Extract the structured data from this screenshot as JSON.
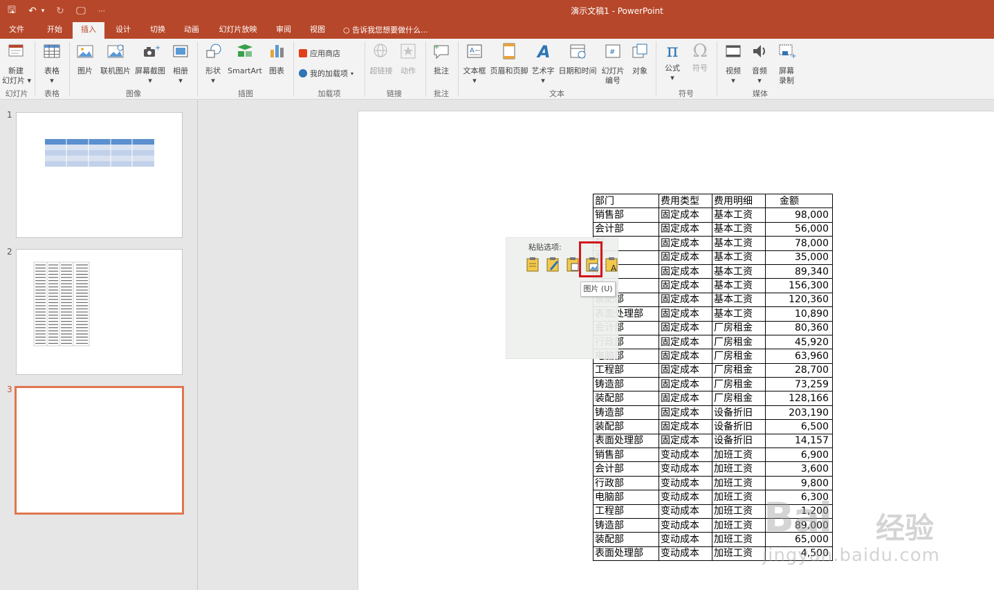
{
  "window": {
    "title": "演示文稿1 - PowerPoint",
    "colors": {
      "accent": "#b7472a",
      "ribbon_bg": "#f3f3f3",
      "selected_border": "#e0754d",
      "highlight_red": "#d2141b"
    }
  },
  "qat": {
    "save": "🖫",
    "undo": "↶",
    "undo_dropdown": "▾",
    "redo": "↻",
    "start_from_beginning": "🖵",
    "customize": "⋯"
  },
  "tabs": [
    "文件",
    "开始",
    "插入",
    "设计",
    "切换",
    "动画",
    "幻灯片放映",
    "审阅",
    "视图"
  ],
  "active_tab": "插入",
  "tell_me": "告诉我您想要做什么...",
  "ribbon": {
    "groups": [
      "幻灯片",
      "表格",
      "图像",
      "插图",
      "加载项",
      "链接",
      "批注",
      "文本",
      "符号",
      "媒体"
    ],
    "buttons": {
      "new_slide": "新建\n幻灯片 ▾",
      "table": "表格\n▾",
      "pictures": "图片",
      "online_pictures": "联机图片",
      "screenshot": "屏幕截图\n▾",
      "photo_album": "相册\n▾",
      "shapes": "形状\n▾",
      "smartart": "SmartArt",
      "chart": "图表",
      "store": "应用商店",
      "my_addins": "我的加载项",
      "hyperlink": "超链接",
      "action": "动作",
      "comment": "批注",
      "text_box": "文本框\n▾",
      "header_footer": "页眉和页脚",
      "wordart": "艺术字\n▾",
      "date_time": "日期和时间",
      "slide_number": "幻灯片\n编号",
      "object": "对象",
      "equation": "公式\n▾",
      "symbol": "符号",
      "video": "视频\n▾",
      "audio": "音频\n▾",
      "screen_recording": "屏幕\n录制"
    },
    "icons": {
      "equation": "π",
      "symbol": "Ω"
    }
  },
  "slides": [
    {
      "number": "1"
    },
    {
      "number": "2"
    },
    {
      "number": "3"
    }
  ],
  "paste_options": {
    "label": "粘贴选项:",
    "tooltip": "图片 (U)",
    "icon_text": "A"
  },
  "table": {
    "header": [
      "部门",
      "费用类型",
      "费用明细",
      "金额"
    ],
    "rows": [
      [
        "销售部",
        "固定成本",
        "基本工资",
        "98,000"
      ],
      [
        "会计部",
        "固定成本",
        "基本工资",
        "56,000"
      ],
      [
        "部",
        "固定成本",
        "基本工资",
        "78,000"
      ],
      [
        "部",
        "固定成本",
        "基本工资",
        "35,000"
      ],
      [
        "部",
        "固定成本",
        "基本工资",
        "89,340"
      ],
      [
        "部",
        "固定成本",
        "基本工资",
        "156,300"
      ],
      [
        "装配部",
        "固定成本",
        "基本工资",
        "120,360"
      ],
      [
        "表面处理部",
        "固定成本",
        "基本工资",
        "10,890"
      ],
      [
        "会计部",
        "固定成本",
        "厂房租金",
        "80,360"
      ],
      [
        "行政部",
        "固定成本",
        "厂房租金",
        "45,920"
      ],
      [
        "电脑部",
        "固定成本",
        "厂房租金",
        "63,960"
      ],
      [
        "工程部",
        "固定成本",
        "厂房租金",
        "28,700"
      ],
      [
        "铸造部",
        "固定成本",
        "厂房租金",
        "73,259"
      ],
      [
        "装配部",
        "固定成本",
        "厂房租金",
        "128,166"
      ],
      [
        "铸造部",
        "固定成本",
        "设备折旧",
        "203,190"
      ],
      [
        "装配部",
        "固定成本",
        "设备折旧",
        "6,500"
      ],
      [
        "表面处理部",
        "固定成本",
        "设备折旧",
        "14,157"
      ],
      [
        "销售部",
        "变动成本",
        "加班工资",
        "6,900"
      ],
      [
        "会计部",
        "变动成本",
        "加班工资",
        "3,600"
      ],
      [
        "行政部",
        "变动成本",
        "加班工资",
        "9,800"
      ],
      [
        "电脑部",
        "变动成本",
        "加班工资",
        "6,300"
      ],
      [
        "工程部",
        "变动成本",
        "加班工资",
        "1,200"
      ],
      [
        "铸造部",
        "变动成本",
        "加班工资",
        "89,000"
      ],
      [
        "装配部",
        "变动成本",
        "加班工资",
        "65,000"
      ],
      [
        "表面处理部",
        "变动成本",
        "加班工资",
        "4,500"
      ]
    ]
  },
  "watermark": {
    "brand": "Bai",
    "brand_cn": "经验",
    "url": "jingyan.baidu.com"
  }
}
